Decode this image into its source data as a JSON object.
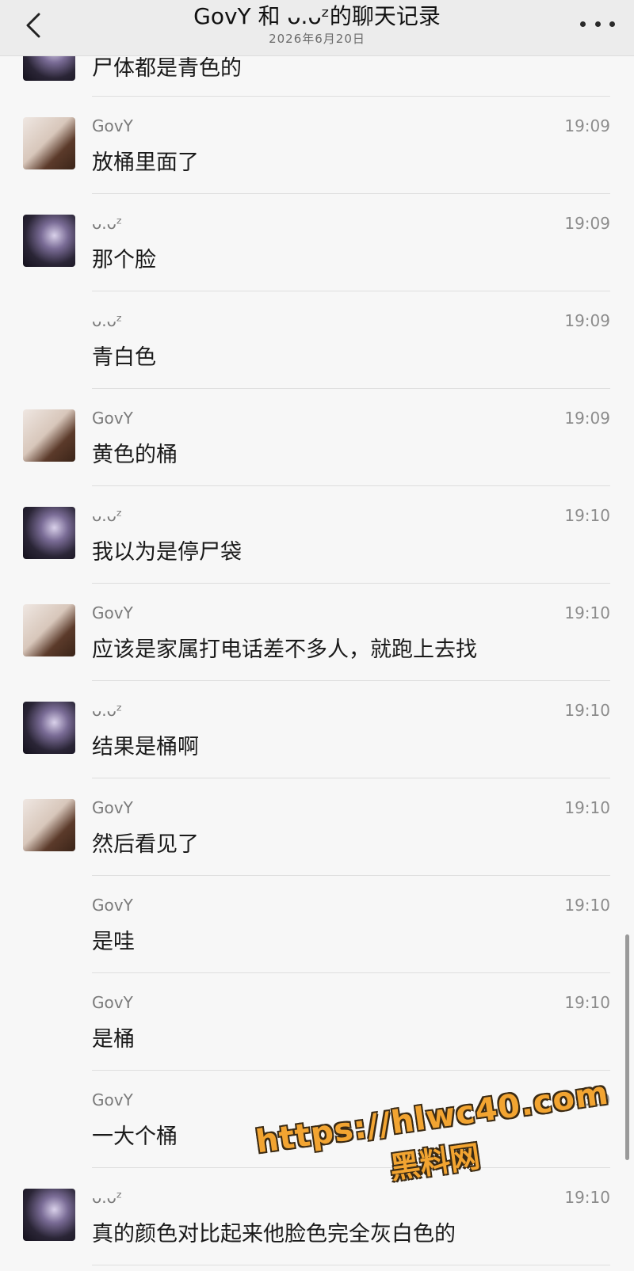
{
  "header": {
    "title": "GovY 和 ᴗ.ᴗᶻ的聊天记录",
    "subtitle": "2026年6月20日"
  },
  "first_message": {
    "text": "尸体都是青色的"
  },
  "messages": [
    {
      "sender": "GovY",
      "avatar": "avatar-govy",
      "time": "19:09",
      "text": "放桶里面了"
    },
    {
      "sender": "ᴗ.ᴗᶻ",
      "avatar": "avatar-uuz",
      "time": "19:09",
      "text": "那个脸"
    },
    {
      "sender": "ᴗ.ᴗᶻ",
      "avatar": "",
      "time": "19:09",
      "text": "青白色"
    },
    {
      "sender": "GovY",
      "avatar": "avatar-govy",
      "time": "19:09",
      "text": "黄色的桶"
    },
    {
      "sender": "ᴗ.ᴗᶻ",
      "avatar": "avatar-uuz",
      "time": "19:10",
      "text": "我以为是停尸袋"
    },
    {
      "sender": "GovY",
      "avatar": "avatar-govy",
      "time": "19:10",
      "text": "应该是家属打电话差不多人，就跑上去找"
    },
    {
      "sender": "ᴗ.ᴗᶻ",
      "avatar": "avatar-uuz",
      "time": "19:10",
      "text": "结果是桶啊"
    },
    {
      "sender": "GovY",
      "avatar": "avatar-govy",
      "time": "19:10",
      "text": "然后看见了"
    },
    {
      "sender": "GovY",
      "avatar": "",
      "time": "19:10",
      "text": "是哇"
    },
    {
      "sender": "GovY",
      "avatar": "",
      "time": "19:10",
      "text": "是桶"
    },
    {
      "sender": "GovY",
      "avatar": "",
      "time": "19:10",
      "text": "一大个桶"
    },
    {
      "sender": "ᴗ.ᴗᶻ",
      "avatar": "avatar-uuz",
      "time": "19:10",
      "text": "真的颜色对比起来他脸色完全灰白色的"
    }
  ],
  "watermark": {
    "url": "https://hlwc40.com",
    "brand": "黑料网"
  },
  "icons": {
    "back": "chevron-left-icon",
    "more": "more-dots-icon"
  },
  "colors": {
    "background": "#f7f7f7",
    "header": "#ececec",
    "watermark": "#f2a431"
  }
}
